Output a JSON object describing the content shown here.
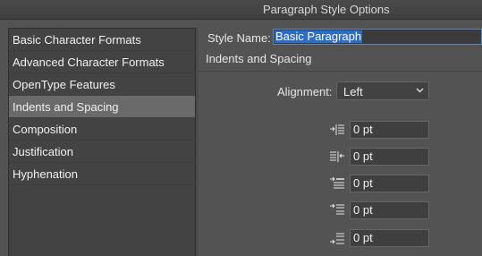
{
  "window": {
    "title": "Paragraph Style Options"
  },
  "sidebar": {
    "items": [
      {
        "label": "Basic Character Formats",
        "selected": false
      },
      {
        "label": "Advanced Character Formats",
        "selected": false
      },
      {
        "label": "OpenType Features",
        "selected": false
      },
      {
        "label": "Indents and Spacing",
        "selected": true
      },
      {
        "label": "Composition",
        "selected": false
      },
      {
        "label": "Justification",
        "selected": false
      },
      {
        "label": "Hyphenation",
        "selected": false
      }
    ]
  },
  "main": {
    "style_name_label": "Style Name:",
    "style_name_value": "Basic Paragraph",
    "section_title": "Indents and Spacing",
    "alignment_label": "Alignment:",
    "alignment_value": "Left",
    "fields": {
      "left_indent": {
        "value": "0 pt",
        "icon": "left-indent-icon"
      },
      "right_indent": {
        "value": "0 pt",
        "icon": "right-indent-icon"
      },
      "first_line_indent": {
        "value": "0 pt",
        "icon": "first-line-indent-icon"
      },
      "space_before": {
        "value": "0 pt",
        "icon": "space-before-icon"
      },
      "space_after": {
        "value": "0 pt",
        "icon": "space-after-icon"
      }
    }
  },
  "colors": {
    "panel": "#535353",
    "sidebar": "#434343",
    "selected_item": "#6a6a6a",
    "selection_highlight": "#2f6cc4"
  }
}
